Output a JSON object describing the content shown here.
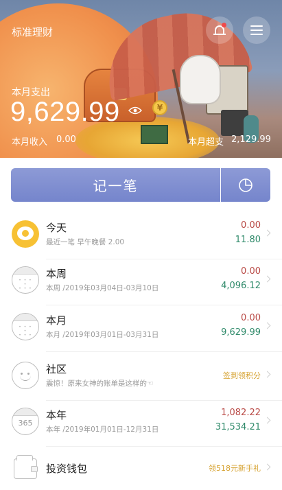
{
  "header": {
    "app_title": "标准理财",
    "expense_label": "本月支出",
    "expense_amount": "9,629.99",
    "income_label": "本月收入",
    "income_value": "0.00",
    "overspend_label": "本月超支",
    "overspend_value": "2,129.99",
    "coin_symbol": "¥",
    "bell_icon": "bell-icon",
    "menu_icon": "menu-icon",
    "eye_icon": "eye-icon"
  },
  "actions": {
    "record_label": "记一笔",
    "report_icon": "pie-chart-icon"
  },
  "rows": [
    {
      "title": "今天",
      "subtitle": "最近一笔 早午晚餐 2.00",
      "expense": "0.00",
      "income": "11.80",
      "icon": "egg-icon"
    },
    {
      "title": "本周",
      "subtitle": "本周 /2019年03月04日-03月10日",
      "expense": "0.00",
      "income": "4,096.12",
      "icon": "calendar-week-icon"
    },
    {
      "title": "本月",
      "subtitle": "本月 /2019年03月01日-03月31日",
      "expense": "0.00",
      "income": "9,629.99",
      "icon": "calendar-month-icon"
    },
    {
      "title": "社区",
      "subtitle": "震惊！原来女神的账单是这样的☜",
      "badge": "签到领积分",
      "icon": "smile-icon"
    },
    {
      "title": "本年",
      "subtitle": "本年 /2019年01月01日-12月31日",
      "expense": "1,082.22",
      "income": "31,534.21",
      "icon": "calendar-year-icon",
      "icon_text": "365"
    },
    {
      "title": "投资钱包",
      "badge": "领518元新手礼",
      "icon": "wallet-icon"
    }
  ],
  "colors": {
    "accent": "#7b8bcf",
    "expense": "#b94a46",
    "income": "#2f8a6a",
    "badge": "#d6a230"
  }
}
